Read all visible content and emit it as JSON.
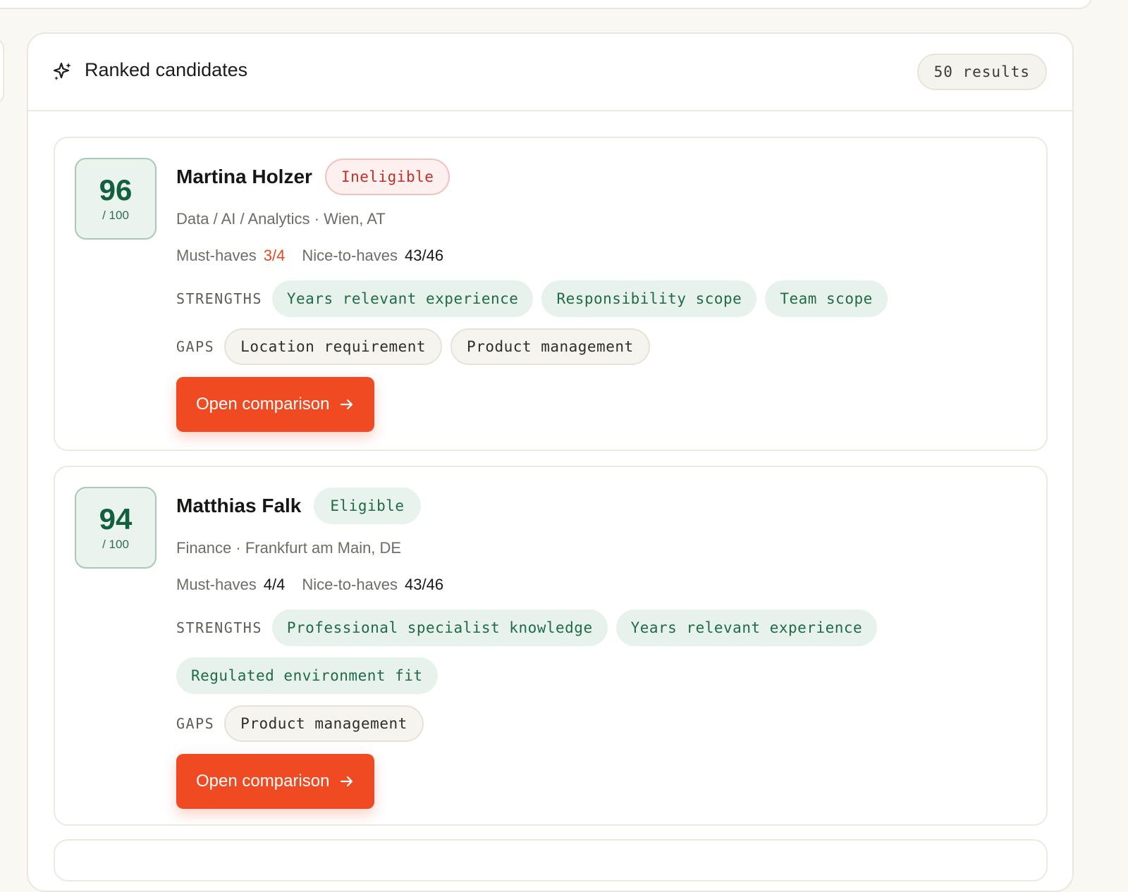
{
  "header": {
    "title": "Ranked candidates",
    "results": "50 results"
  },
  "candidates": [
    {
      "score": "96",
      "score_max": "/ 100",
      "name": "Martina Holzer",
      "status": "Ineligible",
      "meta": "Data / AI / Analytics · Wien, AT",
      "must_label": "Must-haves",
      "must_value": "3/4",
      "nice_label": "Nice-to-haves",
      "nice_value": "43/46",
      "strengths_label": "STRENGTHS",
      "strengths": [
        "Years relevant experience",
        "Responsibility scope",
        "Team scope"
      ],
      "gaps_label": "GAPS",
      "gaps": [
        "Location requirement",
        "Product management"
      ],
      "button": "Open comparison"
    },
    {
      "score": "94",
      "score_max": "/ 100",
      "name": "Matthias Falk",
      "status": "Eligible",
      "meta": "Finance · Frankfurt am Main, DE",
      "must_label": "Must-haves",
      "must_value": "4/4",
      "nice_label": "Nice-to-haves",
      "nice_value": "43/46",
      "strengths_label": "STRENGTHS",
      "strengths": [
        "Professional specialist knowledge",
        "Years relevant experience",
        "Regulated environment fit"
      ],
      "gaps_label": "GAPS",
      "gaps": [
        "Product management"
      ],
      "button": "Open comparison"
    }
  ],
  "colors": {
    "accent": "#f04a23",
    "score_green": "#13603d",
    "warn": "#e4491f"
  }
}
